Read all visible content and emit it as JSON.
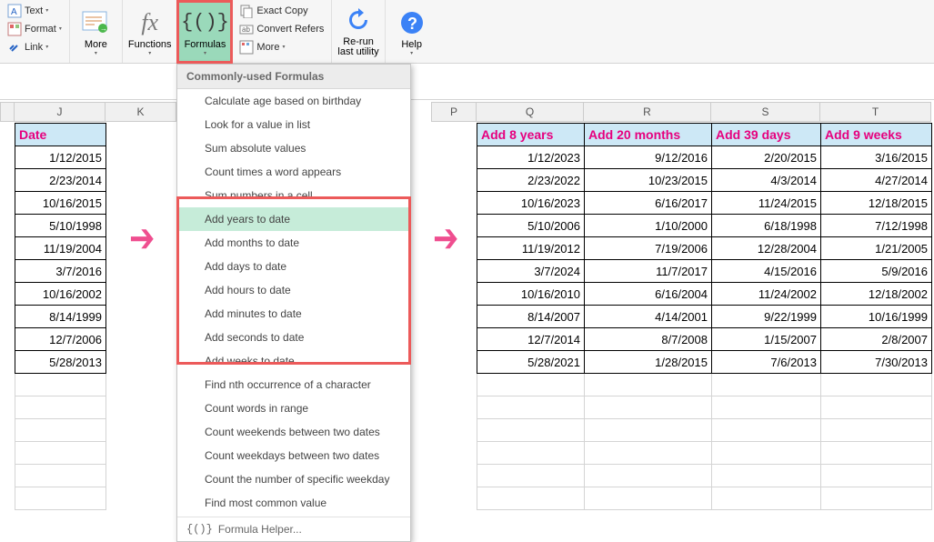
{
  "ribbon": {
    "text": "Text",
    "format": "Format",
    "link": "Link",
    "more1": "More",
    "functions": "Functions",
    "formulas": "Formulas",
    "exact_copy": "Exact Copy",
    "convert_refers": "Convert Refers",
    "more2": "More",
    "rerun": "Re-run",
    "rerun2": "last utility",
    "help": "Help"
  },
  "menu": {
    "header": "Commonly-used Formulas",
    "items": [
      {
        "label": "Calculate age based on birthday"
      },
      {
        "label": "Look for a value in list"
      },
      {
        "label": "Sum absolute values"
      },
      {
        "label": "Count times a word appears"
      },
      {
        "label": "Sum numbers in a cell"
      },
      {
        "label": "Add years to date",
        "hl": true,
        "boxed": true
      },
      {
        "label": "Add months to date",
        "boxed": true
      },
      {
        "label": "Add days to date",
        "boxed": true
      },
      {
        "label": "Add hours to date",
        "boxed": true
      },
      {
        "label": "Add minutes to date",
        "boxed": true
      },
      {
        "label": "Add seconds to date",
        "boxed": true
      },
      {
        "label": "Add weeks to date",
        "boxed": true
      },
      {
        "label": "Find nth occurrence of a character"
      },
      {
        "label": "Count words in range"
      },
      {
        "label": "Count weekends between two dates"
      },
      {
        "label": "Count weekdays between two dates"
      },
      {
        "label": "Count the number of specific weekday"
      },
      {
        "label": "Find most common value"
      }
    ],
    "helper": "Formula Helper..."
  },
  "cols": {
    "J": "J",
    "K": "K",
    "P": "P",
    "Q": "Q",
    "R": "R",
    "S": "S",
    "T": "T"
  },
  "left": {
    "header": "Date",
    "rows": [
      "1/12/2015",
      "2/23/2014",
      "10/16/2015",
      "5/10/1998",
      "11/19/2004",
      "3/7/2016",
      "10/16/2002",
      "8/14/1999",
      "12/7/2006",
      "5/28/2013"
    ]
  },
  "right": {
    "headers": [
      "Add 8 years",
      "Add 20 months",
      "Add 39 days",
      "Add 9 weeks"
    ],
    "rows": [
      [
        "1/12/2023",
        "9/12/2016",
        "2/20/2015",
        "3/16/2015"
      ],
      [
        "2/23/2022",
        "10/23/2015",
        "4/3/2014",
        "4/27/2014"
      ],
      [
        "10/16/2023",
        "6/16/2017",
        "11/24/2015",
        "12/18/2015"
      ],
      [
        "5/10/2006",
        "1/10/2000",
        "6/18/1998",
        "7/12/1998"
      ],
      [
        "11/19/2012",
        "7/19/2006",
        "12/28/2004",
        "1/21/2005"
      ],
      [
        "3/7/2024",
        "11/7/2017",
        "4/15/2016",
        "5/9/2016"
      ],
      [
        "10/16/2010",
        "6/16/2004",
        "11/24/2002",
        "12/18/2002"
      ],
      [
        "8/14/2007",
        "4/14/2001",
        "9/22/1999",
        "10/16/1999"
      ],
      [
        "12/7/2014",
        "8/7/2008",
        "1/15/2007",
        "2/8/2007"
      ],
      [
        "5/28/2021",
        "1/28/2015",
        "7/6/2013",
        "7/30/2013"
      ]
    ]
  }
}
